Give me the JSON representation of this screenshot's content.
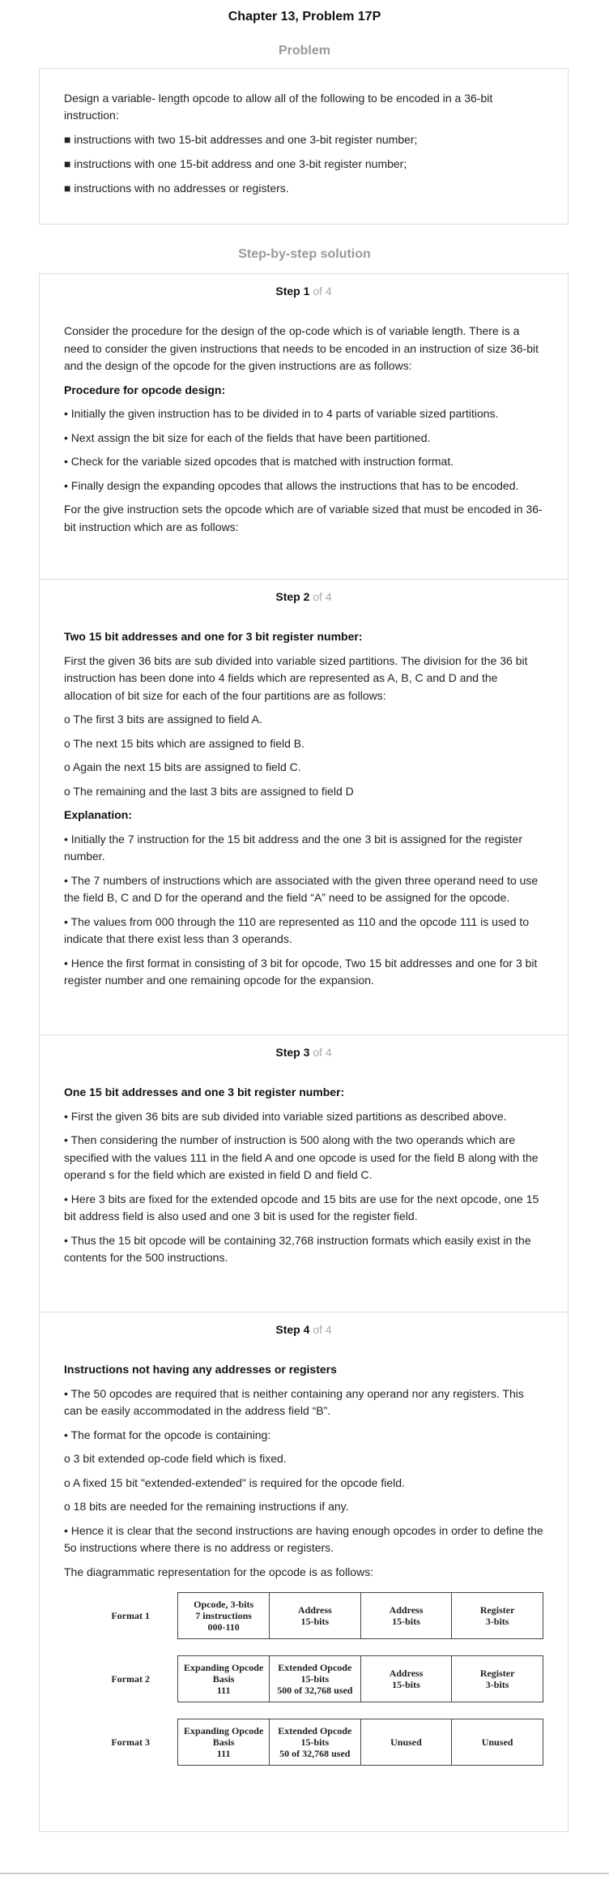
{
  "page_title": "Chapter 13, Problem 17P",
  "problem": {
    "heading": "Problem",
    "paragraphs": [
      "Design a variable- length opcode to allow all of the following to be encoded in a 36-bit instruction:",
      "■ instructions with two 15-bit addresses and one 3-bit register number;",
      "■ instructions with one 15-bit address and one 3-bit register number;",
      "■ instructions with no addresses or registers."
    ]
  },
  "solution_heading": "Step-by-step solution",
  "steps": [
    {
      "label": "Step 1",
      "of": "of 4",
      "paragraphs": [
        {
          "text": "Consider the procedure for the design of the op-code which is of variable length. There is a need to consider the given instructions that needs to be encoded in an instruction of size 36-bit and the design of the opcode for the given instructions are as follows:",
          "bold": false
        },
        {
          "text": "Procedure for opcode design:",
          "bold": true
        },
        {
          "text": "• Initially the given instruction has to be divided in to 4 parts of variable sized partitions.",
          "bold": false
        },
        {
          "text": "• Next assign the bit size for each of the fields that have been partitioned.",
          "bold": false
        },
        {
          "text": "• Check for the variable sized opcodes that is matched with instruction format.",
          "bold": false
        },
        {
          "text": "• Finally design the expanding opcodes that allows the instructions that has to be encoded.",
          "bold": false
        },
        {
          "text": "For the give instruction sets the opcode which are of variable sized that must be encoded in 36-bit instruction which are as follows:",
          "bold": false
        }
      ]
    },
    {
      "label": "Step 2",
      "of": "of 4",
      "paragraphs": [
        {
          "text": "Two 15 bit addresses and one for 3 bit register number:",
          "bold": true
        },
        {
          "text": "First the given 36 bits are sub divided into variable sized partitions. The division for the 36 bit instruction has been done into 4 fields which are represented as A, B, C and D and the allocation of bit size for each of the four partitions are as follows:",
          "bold": false
        },
        {
          "text": "o The first 3 bits are assigned to field A.",
          "bold": false
        },
        {
          "text": "o The next 15 bits which are assigned to field B.",
          "bold": false
        },
        {
          "text": "o Again the next 15 bits are assigned to field C.",
          "bold": false
        },
        {
          "text": "o The remaining and the last 3 bits are assigned to field D",
          "bold": false
        },
        {
          "text": "Explanation:",
          "bold": true
        },
        {
          "text": "• Initially the 7 instruction for the 15 bit address and the one 3 bit is assigned for the register number.",
          "bold": false
        },
        {
          "text": "• The 7 numbers of instructions which are associated with the given three operand need to use the field B, C and D for the operand and the field “A” need to be assigned for the opcode.",
          "bold": false
        },
        {
          "text": "• The values from 000 through the 110 are represented as 110 and the opcode 111 is used to indicate that there exist less than 3 operands.",
          "bold": false
        },
        {
          "text": "• Hence the first format in consisting of 3 bit for opcode, Two 15 bit addresses and one for 3 bit register number and one remaining opcode for the expansion.",
          "bold": false
        }
      ]
    },
    {
      "label": "Step 3",
      "of": "of 4",
      "paragraphs": [
        {
          "text": "One 15 bit addresses and one 3 bit register number:",
          "bold": true
        },
        {
          "text": "• First the given 36 bits are sub divided into variable sized partitions as described above.",
          "bold": false
        },
        {
          "text": "• Then considering the number of instruction is 500 along with the two operands which are specified with the values 111 in the field A and one opcode is used for the field B along with the operand s for the field which are existed in field D and field C.",
          "bold": false
        },
        {
          "text": "• Here 3 bits are fixed for the extended opcode and 15 bits are use for the next opcode, one 15 bit address field is also used and one 3 bit is used for the register field.",
          "bold": false
        },
        {
          "text": "• Thus the 15 bit opcode will be containing 32,768 instruction formats which easily exist in the contents for the 500 instructions.",
          "bold": false
        }
      ]
    },
    {
      "label": "Step 4",
      "of": "of 4",
      "paragraphs": [
        {
          "text": "Instructions not having any addresses or registers",
          "bold": true
        },
        {
          "text": "• The 50 opcodes are required that is neither containing any operand nor any registers. This can be easily accommodated in the address field “B”.",
          "bold": false
        },
        {
          "text": "• The format for the opcode is containing:",
          "bold": false
        },
        {
          "text": "o 3 bit extended op-code field which is fixed.",
          "bold": false
        },
        {
          "text": "o A fixed 15 bit \"extended-extended\" is required for the opcode field.",
          "bold": false
        },
        {
          "text": "o 18 bits are needed for the remaining instructions if any.",
          "bold": false
        },
        {
          "text": "• Hence it is clear that the second instructions are having enough opcodes in order to define the 5o instructions where there is no address or registers.",
          "bold": false
        },
        {
          "text": "The diagrammatic representation for the opcode is as follows:",
          "bold": false
        }
      ]
    }
  ],
  "formats": [
    {
      "label": "Format 1",
      "cells": [
        "Opcode, 3-bits\n7 instructions\n000-110",
        "Address\n15-bits",
        "Address\n15-bits",
        "Register\n3-bits"
      ]
    },
    {
      "label": "Format 2",
      "cells": [
        "Expanding Opcode\nBasis\n111",
        "Extended Opcode\n15-bits\n500 of 32,768 used",
        "Address\n15-bits",
        "Register\n3-bits"
      ]
    },
    {
      "label": "Format 3",
      "cells": [
        "Expanding Opcode\nBasis\n111",
        "Extended Opcode\n15-bits\n50 of 32,768 used",
        "Unused",
        "Unused"
      ]
    }
  ]
}
